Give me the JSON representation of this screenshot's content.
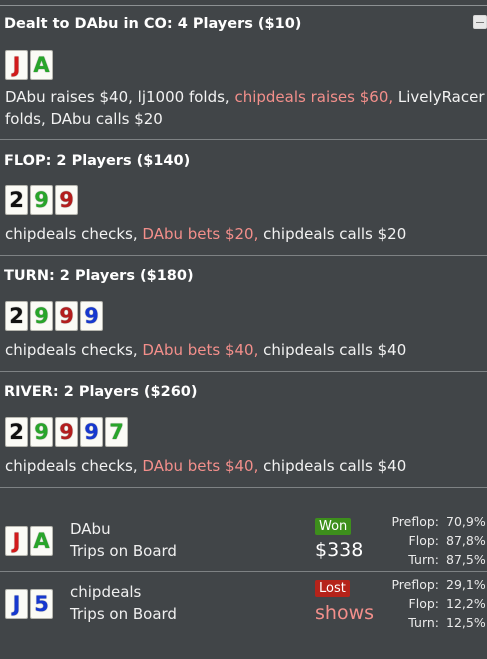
{
  "preflop": {
    "title": "Dealt to DAbu in CO: 4 Players ($10)",
    "hero_cards": [
      "J",
      "A"
    ],
    "action_1": "DAbu raises $40, lj1000 folds, ",
    "action_2": "chipdeals raises $60,",
    "action_3": " LivelyRacer",
    "action_4": "folds, DAbu calls $20"
  },
  "flop": {
    "title": "FLOP: 2 Players ($140)",
    "cards": [
      "2",
      "9",
      "9"
    ],
    "action_1": "chipdeals checks, ",
    "action_2": "DAbu bets $20,",
    "action_3": " chipdeals calls $20"
  },
  "turn": {
    "title": "TURN: 2 Players ($180)",
    "cards": [
      "2",
      "9",
      "9",
      "9"
    ],
    "action_1": "chipdeals checks, ",
    "action_2": "DAbu bets $40,",
    "action_3": " chipdeals calls $40"
  },
  "river": {
    "title": "RIVER: 2 Players ($260)",
    "cards": [
      "2",
      "9",
      "9",
      "9",
      "7"
    ],
    "action_1": "chipdeals checks, ",
    "action_2": "DAbu bets $40,",
    "action_3": " chipdeals calls $40"
  },
  "results": [
    {
      "cards": [
        "J",
        "A"
      ],
      "name": "DAbu",
      "hand": "Trips on Board",
      "status": "Won",
      "amount": "$338",
      "stats": [
        {
          "label": "Preflop:",
          "value": "70,9%"
        },
        {
          "label": "Flop:",
          "value": "87,8%"
        },
        {
          "label": "Turn:",
          "value": "87,5%"
        }
      ]
    },
    {
      "cards": [
        "J",
        "5"
      ],
      "name": "chipdeals",
      "hand": "Trips on Board",
      "status": "Lost",
      "amount": "shows",
      "stats": [
        {
          "label": "Preflop:",
          "value": "29,1%"
        },
        {
          "label": "Flop:",
          "value": "12,2%"
        },
        {
          "label": "Turn:",
          "value": "12,5%"
        }
      ]
    }
  ],
  "colors": {
    "background": "#414548",
    "highlight": "#f38f8b",
    "won_badge": "#3d8f1c",
    "lost_badge": "#b5231a"
  }
}
